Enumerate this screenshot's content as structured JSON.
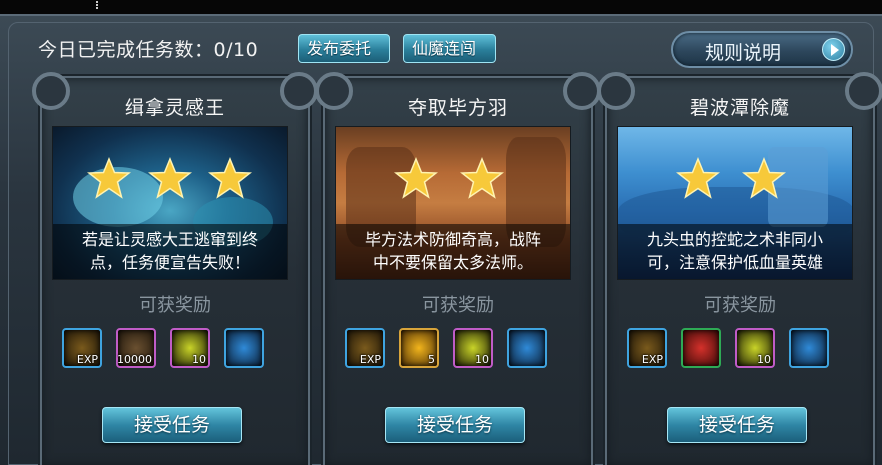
{
  "header": {
    "progress_text": "今日已完成任务数：0/10",
    "tab_post": "发布委托",
    "tab_xianmo": "仙魔连闯",
    "rules_button": "规则说明"
  },
  "reward_label": "可获奖励",
  "accept_label": "接受任务",
  "cards": [
    {
      "title": "缉拿灵感王",
      "stars": 3,
      "desc_line1": "若是让灵感大王逃窜到终",
      "desc_line2": "点，任务便宣告失败！",
      "rewards": [
        {
          "icon": "exp-icon",
          "qty": "EXP"
        },
        {
          "icon": "treasure-chest-icon",
          "qty": "10000"
        },
        {
          "icon": "gold-ore-icon",
          "qty": "10"
        },
        {
          "icon": "blue-crystal-icon",
          "qty": ""
        }
      ]
    },
    {
      "title": "夺取毕方羽",
      "stars": 2,
      "desc_line1": "毕方法术防御奇高，战阵",
      "desc_line2": "中不要保留太多法师。",
      "rewards": [
        {
          "icon": "exp-icon",
          "qty": "EXP"
        },
        {
          "icon": "golden-orb-icon",
          "qty": "5"
        },
        {
          "icon": "gold-ore-icon",
          "qty": "10"
        },
        {
          "icon": "blue-crystal-icon",
          "qty": ""
        }
      ]
    },
    {
      "title": "碧波潭除魔",
      "stars": 2,
      "desc_line1": "九头虫的控蛇之术非同小",
      "desc_line2": "可，注意保护低血量英雄",
      "rewards": [
        {
          "icon": "exp-icon",
          "qty": "EXP"
        },
        {
          "icon": "question-mark-icon",
          "qty": ""
        },
        {
          "icon": "gold-ore-icon",
          "qty": "10"
        },
        {
          "icon": "blue-crystal-icon",
          "qty": ""
        }
      ]
    }
  ]
}
